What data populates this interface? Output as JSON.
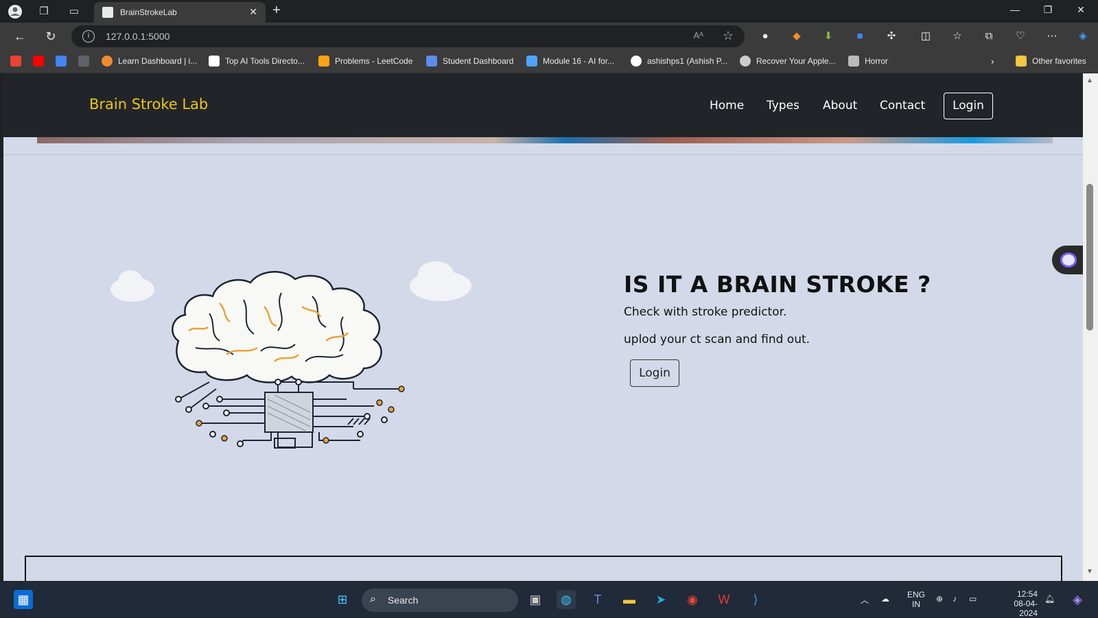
{
  "browser": {
    "tab_title": "BrainStrokeLab",
    "url": "127.0.0.1:5000",
    "reader_mode": "Aᴬ",
    "bookmarks": [
      {
        "label": "",
        "icon": "gmail-icon",
        "color": "#ea4335"
      },
      {
        "label": "",
        "icon": "youtube-icon",
        "color": "#ff0000"
      },
      {
        "label": "",
        "icon": "translate-icon",
        "color": "#4285f4"
      },
      {
        "label": "",
        "icon": "dots-icon",
        "color": "#9aa0a6"
      },
      {
        "label": "Learn Dashboard | i...",
        "icon": "learn-icon",
        "color": "#f28b30"
      },
      {
        "label": "Top AI Tools Directo...",
        "icon": "square-icon",
        "color": "#ffffff"
      },
      {
        "label": "Problems - LeetCode",
        "icon": "leetcode-icon",
        "color": "#ffa116"
      },
      {
        "label": "Student Dashboard",
        "icon": "dashboard-icon",
        "color": "#5b8def"
      },
      {
        "label": "Module 16 - AI for...",
        "icon": "chart-icon",
        "color": "#4fa3ff"
      },
      {
        "label": "ashishps1 (Ashish P...",
        "icon": "github-icon",
        "color": "#ffffff"
      },
      {
        "label": "Recover Your Apple...",
        "icon": "apple-icon",
        "color": "#cccccc"
      },
      {
        "label": "Horror",
        "icon": "horror-icon",
        "color": "#bbbbbb"
      }
    ],
    "other_favorites": "Other favorites"
  },
  "site": {
    "brand": "Brain Stroke Lab",
    "menu": [
      "Home",
      "Types",
      "About",
      "Contact"
    ],
    "login": "Login"
  },
  "hero": {
    "headline": "IS IT A BRAIN STROKE ?",
    "line1": "Check with stroke predictor.",
    "line2": "uplod your ct scan and find out.",
    "cta": "Login"
  },
  "taskbar": {
    "search": "Search",
    "lang": "ENG",
    "region": "IN",
    "time": "12:54",
    "date": "08-04-2024"
  },
  "colors": {
    "brand": "#f0c419",
    "page_bg": "#d3d9e8",
    "nav_bg": "#212529"
  }
}
